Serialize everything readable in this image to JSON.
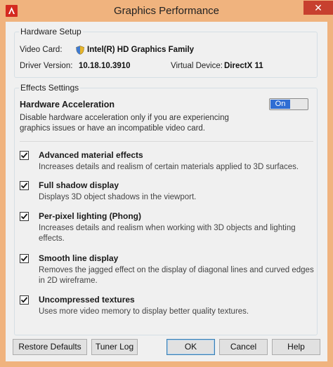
{
  "window": {
    "title": "Graphics Performance",
    "close_glyph": "✕",
    "app_icon": "autocad-icon"
  },
  "hardware_setup": {
    "legend": "Hardware Setup",
    "video_card_label": "Video Card:",
    "video_card_value": "Intel(R) HD Graphics Family",
    "driver_version_label": "Driver Version:",
    "driver_version_value": "10.18.10.3910",
    "virtual_device_label": "Virtual Device:",
    "virtual_device_value": "DirectX 11",
    "status_icon": "shield-icon"
  },
  "effects_settings": {
    "legend": "Effects Settings",
    "hardware_acceleration": {
      "title": "Hardware Acceleration",
      "description": "Disable hardware acceleration only if you are experiencing graphics issues or have an incompatible video card.",
      "toggle_label": "On",
      "toggle_state": true
    },
    "options": [
      {
        "title": "Advanced material effects",
        "description": "Increases details and realism of certain materials applied to 3D surfaces.",
        "checked": true
      },
      {
        "title": "Full shadow display",
        "description": "Displays 3D object shadows in the viewport.",
        "checked": true
      },
      {
        "title": "Per-pixel lighting (Phong)",
        "description": "Increases details and realism when working with 3D objects and lighting effects.",
        "checked": true
      },
      {
        "title": "Smooth line display",
        "description": "Removes the jagged effect on the display of diagonal lines and curved edges in 2D wireframe.",
        "checked": true
      },
      {
        "title": "Uncompressed textures",
        "description": "Uses more video memory to display better quality textures.",
        "checked": true
      }
    ]
  },
  "buttons": {
    "restore_defaults": "Restore Defaults",
    "tuner_log": "Tuner Log",
    "ok": "OK",
    "cancel": "Cancel",
    "help": "Help"
  },
  "colors": {
    "title_bar": "#f0b37e",
    "close_button": "#c7402f",
    "toggle_on": "#2f6dd3",
    "client_bg": "#f0f0f0"
  }
}
